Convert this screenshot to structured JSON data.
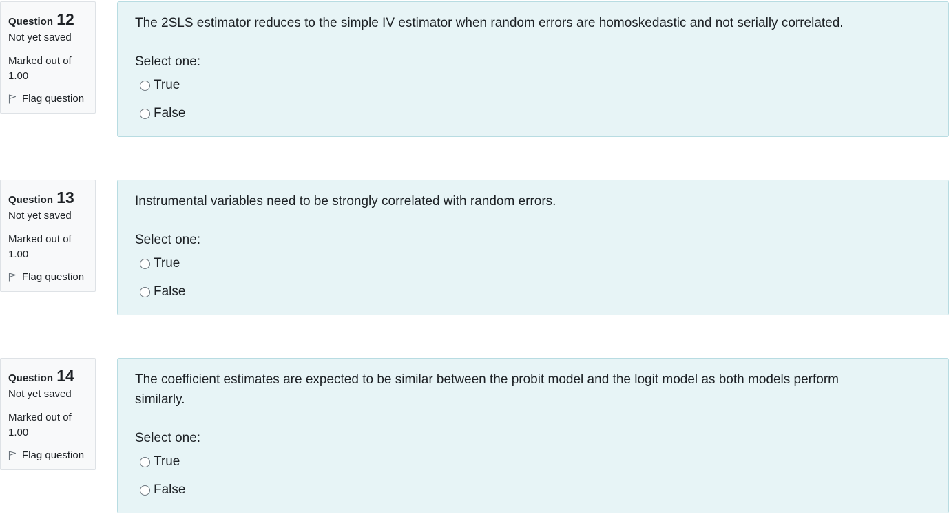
{
  "questions": [
    {
      "prefix": "Question",
      "number": "12",
      "state": "Not yet saved",
      "grade": "Marked out of 1.00",
      "flag_label": "Flag question",
      "text": "The 2SLS estimator reduces to the simple IV estimator when random errors are homoskedastic and not serially correlated.",
      "prompt": "Select one:",
      "options": [
        "True",
        "False"
      ],
      "selected": null
    },
    {
      "prefix": "Question",
      "number": "13",
      "state": "Not yet saved",
      "grade": "Marked out of 1.00",
      "flag_label": "Flag question",
      "text": "Instrumental variables need to be strongly correlated with random errors.",
      "prompt": "Select one:",
      "options": [
        "True",
        "False"
      ],
      "selected": null
    },
    {
      "prefix": "Question",
      "number": "14",
      "state": "Not yet saved",
      "grade": "Marked out of 1.00",
      "flag_label": "Flag question",
      "text": "The coefficient estimates are expected to be similar between the probit model and the logit model as both models perform similarly.",
      "prompt": "Select one:",
      "options": [
        "True",
        "False"
      ],
      "selected": null
    }
  ],
  "icons": {
    "flag": "flag-outline-icon",
    "radio": "radio-unchecked-icon"
  },
  "colors": {
    "content_bg": "#e7f4f6",
    "content_border": "#b8dce2",
    "info_bg": "#f8f9fa",
    "info_border": "#dee2e6",
    "text": "#1d2125"
  }
}
